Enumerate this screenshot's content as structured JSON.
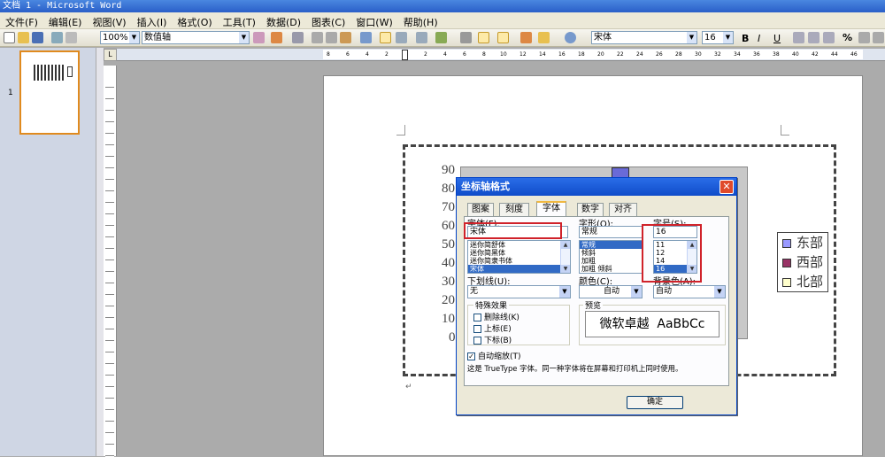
{
  "app": {
    "title": "文档 1 - Microsoft Word"
  },
  "menu": [
    "文件(F)",
    "编辑(E)",
    "视图(V)",
    "插入(I)",
    "格式(O)",
    "工具(T)",
    "数据(D)",
    "图表(C)",
    "窗口(W)",
    "帮助(H)"
  ],
  "toolbar": {
    "zoom": "100%",
    "object_select": "数值轴",
    "font_name": "宋体",
    "font_size": "16",
    "bold": "B",
    "italic": "I",
    "underline": "U",
    "percent": "%"
  },
  "sidebar": {
    "page_number": "1"
  },
  "ruler": {
    "marks": [
      "8",
      "6",
      "4",
      "2",
      "2",
      "2",
      "4",
      "6",
      "8",
      "10",
      "12",
      "14",
      "16",
      "18",
      "20",
      "22",
      "24",
      "26",
      "28",
      "30",
      "32",
      "34",
      "36",
      "38",
      "40",
      "42",
      "44",
      "46",
      "48"
    ]
  },
  "chart": {
    "y_ticks": [
      "90",
      "80",
      "70",
      "60",
      "50",
      "40",
      "30",
      "20",
      "10",
      "0"
    ],
    "legend": [
      {
        "label": "东部",
        "color": "#9999ff"
      },
      {
        "label": "西部",
        "color": "#993366"
      },
      {
        "label": "北部",
        "color": "#ffffcc"
      }
    ]
  },
  "dialog": {
    "title": "坐标轴格式",
    "close": "✕",
    "tabs": [
      "图案",
      "刻度",
      "字体",
      "数字",
      "对齐"
    ],
    "active_tab": "字体",
    "font": {
      "label": "字体(F):",
      "value": "宋体",
      "items": [
        "迷你简舒体",
        "迷你简黑体",
        "迷你简隶书体",
        "宋体"
      ]
    },
    "style": {
      "label": "字形(O):",
      "value": "常规",
      "items": [
        "常规",
        "倾斜",
        "加粗",
        "加粗 倾斜"
      ]
    },
    "size": {
      "label": "字号(S):",
      "value": "16",
      "items": [
        "11",
        "12",
        "14",
        "16"
      ]
    },
    "underline": {
      "label": "下划线(U):",
      "value": "无"
    },
    "color": {
      "label": "颜色(C):",
      "value": "自动"
    },
    "background": {
      "label": "背景色(A):",
      "value": "自动"
    },
    "effects": {
      "label": "特殊效果",
      "strikethrough": "删除线(K)",
      "superscript": "上标(E)",
      "subscript": "下标(B)"
    },
    "preview": {
      "label": "预览",
      "text": "微软卓越  AaBbCc"
    },
    "autoscale": {
      "label": "自动缩放(T)",
      "checked": "✓"
    },
    "note": "这是 TrueType 字体。同一种字体将在屏幕和打印机上同时使用。",
    "ok": "确定"
  }
}
